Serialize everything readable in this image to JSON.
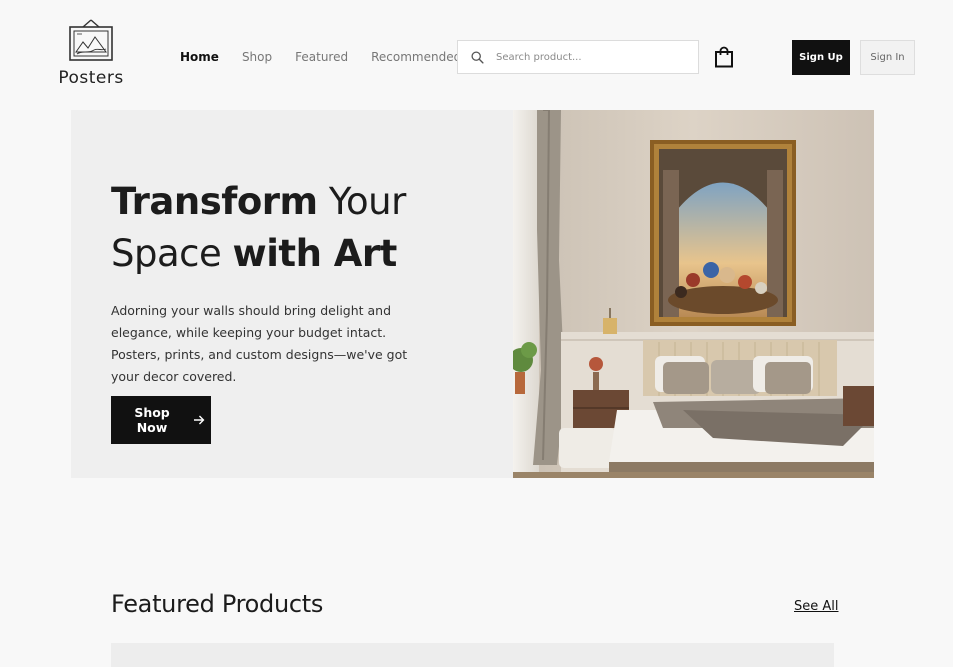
{
  "brand": {
    "name": "Posters",
    "logo_icon": "framed-picture-icon"
  },
  "nav": {
    "items": [
      {
        "label": "Home",
        "active": true
      },
      {
        "label": "Shop",
        "active": false
      },
      {
        "label": "Featured",
        "active": false
      },
      {
        "label": "Recommended",
        "active": false
      }
    ]
  },
  "search": {
    "placeholder": "Search product...",
    "value": "",
    "icon": "search-icon"
  },
  "cart": {
    "icon": "shopping-bag-icon"
  },
  "auth": {
    "sign_up_label": "Sign Up",
    "sign_in_label": "Sign In"
  },
  "hero": {
    "title_bold_1": "Transform",
    "title_normal_1": " Your",
    "title_normal_2": "Space ",
    "title_bold_2": "with Art",
    "description": "Adorning your walls should bring delight and elegance, while keeping your budget intact. Posters, prints, and custom designs—we've got your decor covered.",
    "cta_label": "Shop Now",
    "cta_icon": "arrow-right-icon"
  },
  "featured": {
    "title": "Featured Products",
    "see_all_label": "See All"
  },
  "colors": {
    "primary": "#111111",
    "background": "#f8f8f8",
    "hero_bg": "#efefef"
  }
}
